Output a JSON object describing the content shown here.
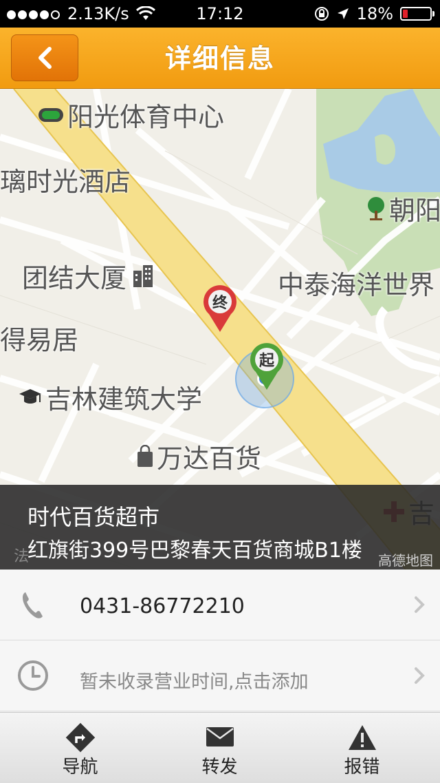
{
  "status_bar": {
    "network_speed": "2.13K/s",
    "time": "17:12",
    "battery": "18%",
    "battery_level": 0.18,
    "signal_bars_filled": 4,
    "signal_bars_total": 5
  },
  "nav": {
    "title": "详细信息",
    "back_icon": "chevron-left-icon"
  },
  "map": {
    "labels": {
      "sun_sports_center": "阳光体育中心",
      "glass_hotel": "璃时光酒店",
      "chaoyang": "朝阳",
      "unity_building": "团结大厦",
      "zhongtai_ocean": "中泰海洋世界",
      "deyi_ju": "得易居",
      "jilin_jianzhu": "吉林建筑大学",
      "wanda_store": "万达百货",
      "partial_ji": "吉"
    },
    "pins": {
      "end": "终",
      "start": "起"
    }
  },
  "place": {
    "name": "时代百货超市",
    "address": "红旗街399号巴黎春天百货商城B1楼",
    "map_brand": "高德地图",
    "partial_label": "法"
  },
  "details": {
    "phone": "0431-86772210",
    "hours_placeholder": "暂未收录营业时间,点击添加"
  },
  "tabs": [
    {
      "label": "导航",
      "icon": "navigation-icon"
    },
    {
      "label": "转发",
      "icon": "envelope-icon"
    },
    {
      "label": "报错",
      "icon": "warning-icon"
    }
  ],
  "colors": {
    "accent": "#f5a623",
    "status_battery": "#e0202a"
  }
}
